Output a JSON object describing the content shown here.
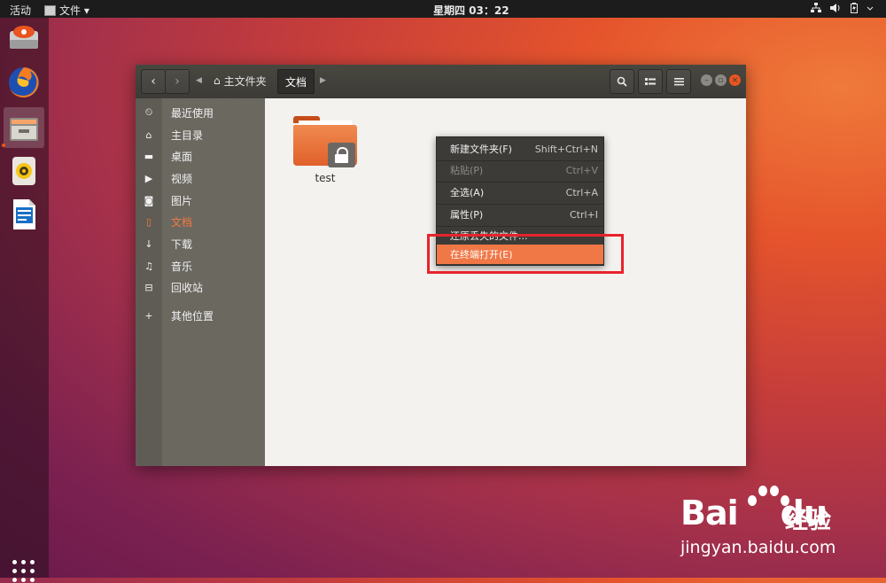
{
  "topbar": {
    "activities": "活动",
    "app_menu": "文件 ▾",
    "clock": "星期四 03：22",
    "tray": [
      "network-icon",
      "volume-icon",
      "battery-icon",
      "power-menu-icon"
    ]
  },
  "dock": {
    "apps": [
      "install-disc-icon",
      "firefox-icon",
      "files-icon",
      "rhythmbox-icon",
      "libreoffice-writer-icon"
    ],
    "show_apps": "apps-grid-icon"
  },
  "window": {
    "breadcrumb": {
      "home": "主文件夹",
      "current": "文档"
    },
    "sidebar": {
      "items": [
        {
          "icon": "⏲",
          "label": "最近使用"
        },
        {
          "icon": "⌂",
          "label": "主目录"
        },
        {
          "icon": "▬",
          "label": "桌面"
        },
        {
          "icon": "▶",
          "label": "视频"
        },
        {
          "icon": "◙",
          "label": "图片"
        },
        {
          "icon": "▯",
          "label": "文档",
          "selected": true
        },
        {
          "icon": "↓",
          "label": "下载"
        },
        {
          "icon": "♫",
          "label": "音乐"
        },
        {
          "icon": "⊟",
          "label": "回收站"
        },
        {
          "icon": "+",
          "label": "其他位置"
        }
      ]
    },
    "files": [
      {
        "name": "test",
        "type": "locked-folder"
      }
    ]
  },
  "context_menu": {
    "items": [
      {
        "label": "新建文件夹(F)",
        "accel": "Shift+Ctrl+N"
      },
      {
        "label": "粘贴(P)",
        "accel": "Ctrl+V",
        "disabled": true
      },
      {
        "label": "全选(A)",
        "accel": "Ctrl+A"
      },
      {
        "label": "属性(P)",
        "accel": "Ctrl+I"
      },
      {
        "label": "还原丢失的文件...",
        "accel": ""
      },
      {
        "label": "在终端打开(E)",
        "accel": "",
        "selected": true
      }
    ]
  },
  "watermark": {
    "brand": "Bai",
    "brand2": "du",
    "brand_cn": "经验",
    "url": "jingyan.baidu.com"
  },
  "colors": {
    "accent": "#f07746",
    "highlight_box": "#e8232b",
    "panel": "#3c3b37"
  }
}
